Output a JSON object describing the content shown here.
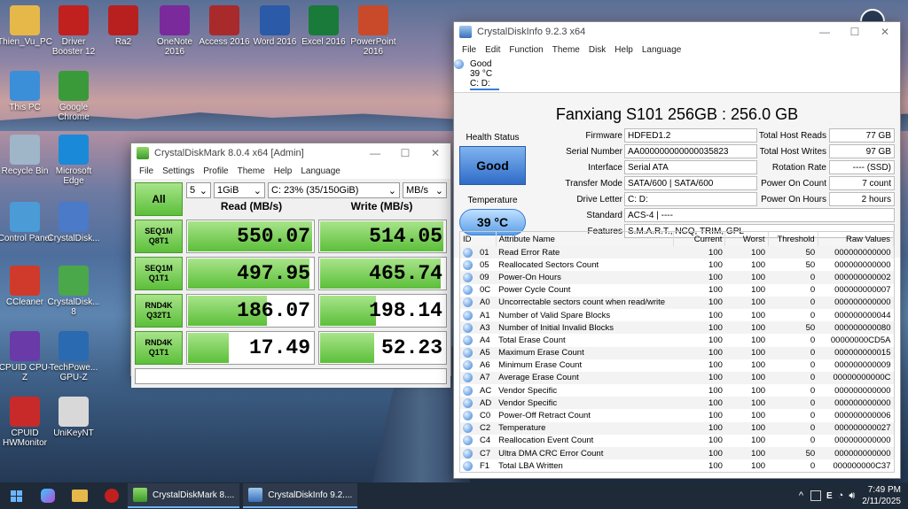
{
  "desktop": {
    "icons_col1": [
      {
        "label": "Thien_Vu_PC",
        "icon": "folder-icon",
        "color": "#e6b84a"
      },
      {
        "label": "This PC",
        "icon": "computer-icon",
        "color": "#3b8fd8"
      },
      {
        "label": "Recycle Bin",
        "icon": "recycle-bin-icon",
        "color": "#9fb5c8"
      },
      {
        "label": "Control Panel",
        "icon": "control-panel-icon",
        "color": "#4a9bd6"
      },
      {
        "label": "CCleaner",
        "icon": "ccleaner-icon",
        "color": "#d03a2a"
      },
      {
        "label": "CPUID CPU-Z",
        "icon": "cpuz-icon",
        "color": "#6a3aa8"
      },
      {
        "label": "CPUID HWMonitor",
        "icon": "hwmonitor-icon",
        "color": "#c82a2a"
      }
    ],
    "icons_col2": [
      {
        "label": "Driver Booster 12",
        "icon": "driver-booster-icon",
        "color": "#c0201e"
      },
      {
        "label": "Google Chrome",
        "icon": "chrome-icon",
        "color": "#3a9a3a"
      },
      {
        "label": "Microsoft Edge",
        "icon": "edge-icon",
        "color": "#1a8ad8"
      },
      {
        "label": "CrystalDisk...",
        "icon": "crystaldiskinfo-icon",
        "color": "#4a7ac8"
      },
      {
        "label": "CrystalDisk... 8",
        "icon": "crystaldiskmark-icon",
        "color": "#4aa84a"
      },
      {
        "label": "TechPowe... GPU-Z",
        "icon": "gpuz-icon",
        "color": "#2a6ab0"
      },
      {
        "label": "UniKeyNT",
        "icon": "unikey-icon",
        "color": "#d8d8d8"
      }
    ],
    "icons_row1": [
      {
        "label": "Ra2",
        "icon": "ra2-icon",
        "color": "#b82020"
      },
      {
        "label": "OneNote 2016",
        "icon": "onenote-icon",
        "color": "#7a2a9a"
      },
      {
        "label": "Access 2016",
        "icon": "access-icon",
        "color": "#a82a2a"
      },
      {
        "label": "Word 2016",
        "icon": "word-icon",
        "color": "#2a5aa8"
      },
      {
        "label": "Excel 2016",
        "icon": "excel-icon",
        "color": "#1a7a3a"
      },
      {
        "label": "PowerPoint 2016",
        "icon": "powerpoint-icon",
        "color": "#c84a2a"
      }
    ]
  },
  "cdm": {
    "title": "CrystalDiskMark 8.0.4 x64 [Admin]",
    "menu": [
      "File",
      "Settings",
      "Profile",
      "Theme",
      "Help",
      "Language"
    ],
    "all_label": "All",
    "count": "5",
    "size": "1GiB",
    "drive": "C: 23% (35/150GiB)",
    "unit": "MB/s",
    "read_header": "Read (MB/s)",
    "write_header": "Write (MB/s)",
    "rows": [
      {
        "l1": "SEQ1M",
        "l2": "Q8T1",
        "read": "550.07",
        "write": "514.05",
        "read_frac": 0.98,
        "write_frac": 0.97
      },
      {
        "l1": "SEQ1M",
        "l2": "Q1T1",
        "read": "497.95",
        "write": "465.74",
        "read_frac": 0.96,
        "write_frac": 0.95
      },
      {
        "l1": "RND4K",
        "l2": "Q32T1",
        "read": "186.07",
        "write": "198.14",
        "read_frac": 0.62,
        "write_frac": 0.44
      },
      {
        "l1": "RND4K",
        "l2": "Q1T1",
        "read": "17.49",
        "write": "52.23",
        "read_frac": 0.32,
        "write_frac": 0.43
      }
    ]
  },
  "cdi": {
    "title": "CrystalDiskInfo 9.2.3 x64",
    "menu": [
      "File",
      "Edit",
      "Function",
      "Theme",
      "Disk",
      "Help",
      "Language"
    ],
    "strip": {
      "status": "Good",
      "temp": "39 °C",
      "drive": "C: D:"
    },
    "model": "Fanxiang S101 256GB : 256.0 GB",
    "health_label": "Health Status",
    "health": "Good",
    "temp_label": "Temperature",
    "temp": "39 °C",
    "fields": {
      "firmware_l": "Firmware",
      "firmware": "HDFED1.2",
      "serial_l": "Serial Number",
      "serial": "AA000000000000035823",
      "interface_l": "Interface",
      "interface": "Serial ATA",
      "transfer_l": "Transfer Mode",
      "transfer": "SATA/600 | SATA/600",
      "letter_l": "Drive Letter",
      "letter": "C: D:",
      "standard_l": "Standard",
      "standard": "ACS-4 | ----",
      "features_l": "Features",
      "features": "S.M.A.R.T., NCQ, TRIM, GPL",
      "reads_l": "Total Host Reads",
      "reads": "77 GB",
      "writes_l": "Total Host Writes",
      "writes": "97 GB",
      "rotation_l": "Rotation Rate",
      "rotation": "---- (SSD)",
      "count_l": "Power On Count",
      "count": "7 count",
      "hours_l": "Power On Hours",
      "hours": "2 hours"
    },
    "columns": [
      "ID",
      "Attribute Name",
      "Current",
      "Worst",
      "Threshold",
      "Raw Values"
    ],
    "attributes": [
      [
        "01",
        "Read Error Rate",
        "100",
        "100",
        "50",
        "000000000000"
      ],
      [
        "05",
        "Reallocated Sectors Count",
        "100",
        "100",
        "50",
        "000000000000"
      ],
      [
        "09",
        "Power-On Hours",
        "100",
        "100",
        "0",
        "000000000002"
      ],
      [
        "0C",
        "Power Cycle Count",
        "100",
        "100",
        "0",
        "000000000007"
      ],
      [
        "A0",
        "Uncorrectable sectors count when read/write",
        "100",
        "100",
        "0",
        "000000000000"
      ],
      [
        "A1",
        "Number of Valid Spare Blocks",
        "100",
        "100",
        "0",
        "000000000044"
      ],
      [
        "A3",
        "Number of Initial Invalid Blocks",
        "100",
        "100",
        "50",
        "000000000080"
      ],
      [
        "A4",
        "Total Erase Count",
        "100",
        "100",
        "0",
        "00000000CD5A"
      ],
      [
        "A5",
        "Maximum Erase Count",
        "100",
        "100",
        "0",
        "000000000015"
      ],
      [
        "A6",
        "Minimum Erase Count",
        "100",
        "100",
        "0",
        "000000000009"
      ],
      [
        "A7",
        "Average Erase Count",
        "100",
        "100",
        "0",
        "00000000000C"
      ],
      [
        "AC",
        "Vendor Specific",
        "100",
        "100",
        "0",
        "000000000000"
      ],
      [
        "AD",
        "Vendor Specific",
        "100",
        "100",
        "0",
        "000000000000"
      ],
      [
        "C0",
        "Power-Off Retract Count",
        "100",
        "100",
        "0",
        "000000000006"
      ],
      [
        "C2",
        "Temperature",
        "100",
        "100",
        "0",
        "000000000027"
      ],
      [
        "C4",
        "Reallocation Event Count",
        "100",
        "100",
        "0",
        "000000000000"
      ],
      [
        "C7",
        "Ultra DMA CRC Error Count",
        "100",
        "100",
        "50",
        "000000000000"
      ],
      [
        "F1",
        "Total LBA Written",
        "100",
        "100",
        "0",
        "000000000C37"
      ]
    ]
  },
  "taskbar": {
    "apps": [
      {
        "label": "CrystalDiskMark 8....",
        "icon": "crystaldiskmark-icon"
      },
      {
        "label": "CrystalDiskInfo 9.2....",
        "icon": "crystaldiskinfo-icon"
      }
    ],
    "time": "7:49 PM",
    "date": "2/11/2025"
  }
}
